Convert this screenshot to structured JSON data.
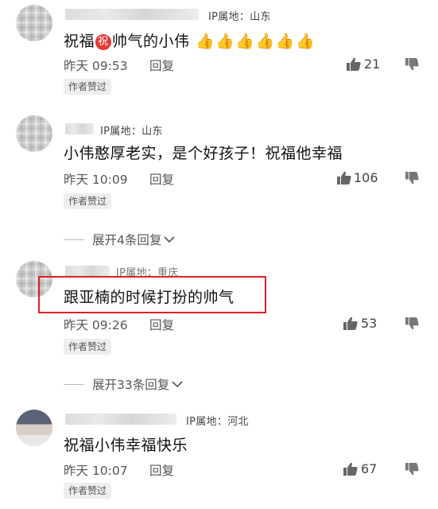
{
  "comments": [
    {
      "ip": "IP属地：山东",
      "text_before": "祝福",
      "inline_badge": "祝",
      "text_after": "帅气的小伟",
      "emojis": [
        "👍",
        "👍",
        "👍",
        "👍",
        "👍",
        "👍"
      ],
      "time": "昨天 09:53",
      "reply": "回复",
      "likes": "21",
      "author_badge": "作者赞过"
    },
    {
      "ip": "IP属地：山东",
      "text": "小伟憨厚老实，是个好孩子！祝福他幸福",
      "time": "昨天 10:09",
      "reply": "回复",
      "likes": "106",
      "author_badge": "作者赞过",
      "expand": "展开4条回复"
    },
    {
      "ip": "IP属地：重庆",
      "text": "跟亚楠的时候打扮的帅气",
      "time": "昨天 09:26",
      "reply": "回复",
      "likes": "53",
      "author_badge": "作者赞过",
      "expand": "展开33条回复"
    },
    {
      "ip": "IP属地：河北",
      "text": "祝福小伟幸福快乐",
      "time": "昨天 10:07",
      "reply": "回复",
      "likes": "67",
      "author_badge": "作者赞过"
    }
  ],
  "icons": {
    "like": "thumb-up-icon",
    "dislike": "thumb-down-icon",
    "expand": "chevron-down-icon"
  },
  "colors": {
    "highlight_box": "#e02020",
    "zhu_badge": "#e53935"
  }
}
